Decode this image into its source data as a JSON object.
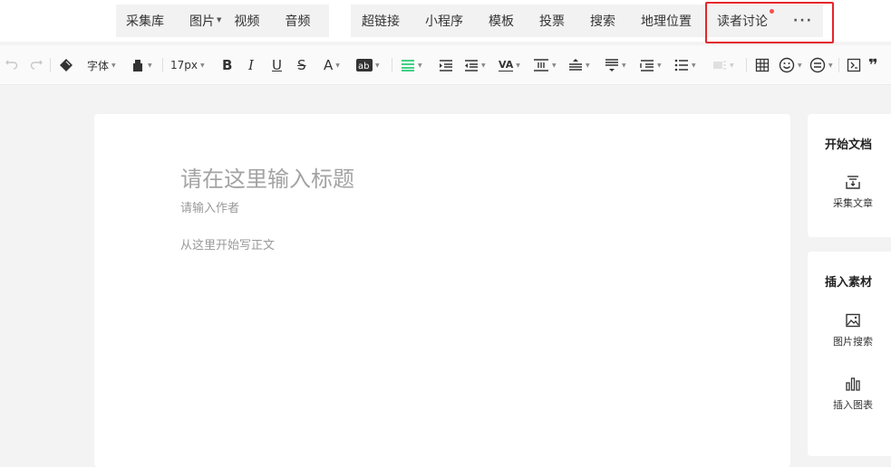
{
  "insert_bar": {
    "group1": [
      {
        "label": "采集库",
        "dropdown": false
      },
      {
        "label": "图片",
        "dropdown": true
      },
      {
        "label": "视频",
        "dropdown": false
      },
      {
        "label": "音频",
        "dropdown": false
      }
    ],
    "group2": [
      {
        "label": "超链接"
      },
      {
        "label": "小程序"
      },
      {
        "label": "模板"
      },
      {
        "label": "投票"
      },
      {
        "label": "搜索"
      },
      {
        "label": "地理位置"
      },
      {
        "label": "读者讨论",
        "badge": "red-dot"
      }
    ],
    "more_label": "···"
  },
  "format_bar": {
    "font_label": "字体",
    "font_size_label": "17px",
    "icons": [
      "undo-icon",
      "redo-icon",
      "format-painter-icon",
      "font-family-dropdown",
      "clear-format-icon",
      "font-size-dropdown",
      "bold-icon",
      "italic-icon",
      "underline-icon",
      "strikethrough-icon",
      "font-color-icon",
      "background-color-icon",
      "align-justify-icon",
      "indent-icon",
      "outdent-icon",
      "letter-spacing-icon",
      "line-height-icon",
      "paragraph-spacing-before-icon",
      "paragraph-spacing-after-icon",
      "ordered-list-icon",
      "unordered-list-icon",
      "divider-icon",
      "table-icon",
      "emoji-icon",
      "more-style-icon",
      "code-icon",
      "quote-icon"
    ],
    "accent_color": "#07c160"
  },
  "editor": {
    "title_placeholder": "请在这里输入标题",
    "author_placeholder": "请输入作者",
    "body_placeholder": "从这里开始写正文"
  },
  "sidebar": {
    "start_doc": {
      "title": "开始文档",
      "items": [
        {
          "label": "采集文章",
          "icon": "collect-article-icon"
        }
      ]
    },
    "insert_material": {
      "title": "插入素材",
      "items": [
        {
          "label": "图片搜索",
          "icon": "image-search-icon"
        },
        {
          "label": "插入图表",
          "icon": "chart-icon"
        }
      ]
    }
  },
  "colors": {
    "highlight_border": "#e4262b",
    "badge": "#fa5151"
  }
}
